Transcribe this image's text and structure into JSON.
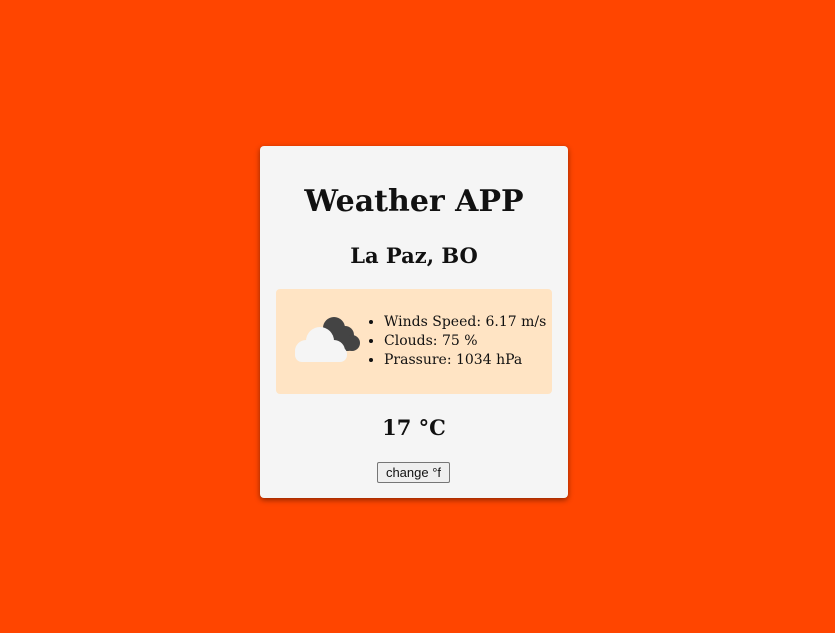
{
  "app": {
    "title": "Weather APP"
  },
  "location": {
    "name": "La Paz, BO"
  },
  "weather": {
    "icon": "cloud-icon",
    "details": [
      "Winds Speed: 6.17 m/s",
      "Clouds: 75 %",
      "Prassure: 1034 hPa"
    ]
  },
  "temperature": {
    "display": "17 °C"
  },
  "controls": {
    "change_unit_label": "change °f"
  },
  "colors": {
    "background": "#ff4500",
    "card": "#f5f5f5",
    "info_box": "#ffe4c4"
  }
}
